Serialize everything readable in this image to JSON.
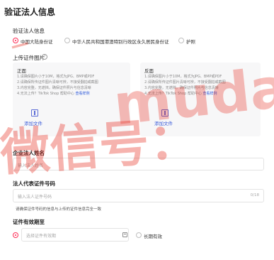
{
  "page": {
    "title": "验证法人信息"
  },
  "id_type": {
    "label": "验证法人信息",
    "options": [
      {
        "label": "中国大陆身份证",
        "selected": true
      },
      {
        "label": "中华人民共和国港澳特别行政区永久居民身份证",
        "selected": false
      },
      {
        "label": "护照",
        "selected": false
      }
    ]
  },
  "upload": {
    "label": "上传证件图片",
    "help_icon": "question-icon",
    "front": {
      "title": "正面",
      "rules": [
        "1.请确保图片小于10M，格式为JPG、BMP或PDF",
        "2.请确保所传证件图片清晰可辨，不接受翻拍或截图",
        "3.内容完整，无遮挡，确保证件照片与信息清晰",
        "4.无法上传？TikTok Shop 帮助中心"
      ],
      "rule_link": "查看样例",
      "add": "添加文件"
    },
    "back": {
      "title": "反面",
      "rules": [
        "1.请确保图片小于10M，格式为JPG、BMP或PDF",
        "2.请确保所传证件图片清晰可辨，不接受翻拍或截图",
        "3.内容完整，无遮挡，确保证件照片与信息清晰",
        "4.无法上传？TikTok Shop 帮助中心"
      ],
      "rule_link": "查看样例",
      "add": "添加文件"
    }
  },
  "legal_name": {
    "label": "企业法人姓名",
    "placeholder": "输入法人姓名"
  },
  "id_number": {
    "label": "法人代表证件号码",
    "placeholder": "输入法人证件号码",
    "count": "0/18",
    "helper": "请确保证件号码的信息与上传的证件信息完全一致"
  },
  "validity": {
    "label": "证件有效期至",
    "placeholder": "选择证件有效期",
    "long_term": "长期有效"
  },
  "colors": {
    "accent": "#fe2c55",
    "link": "#2b57d9",
    "watermark": "#e8271b"
  }
}
